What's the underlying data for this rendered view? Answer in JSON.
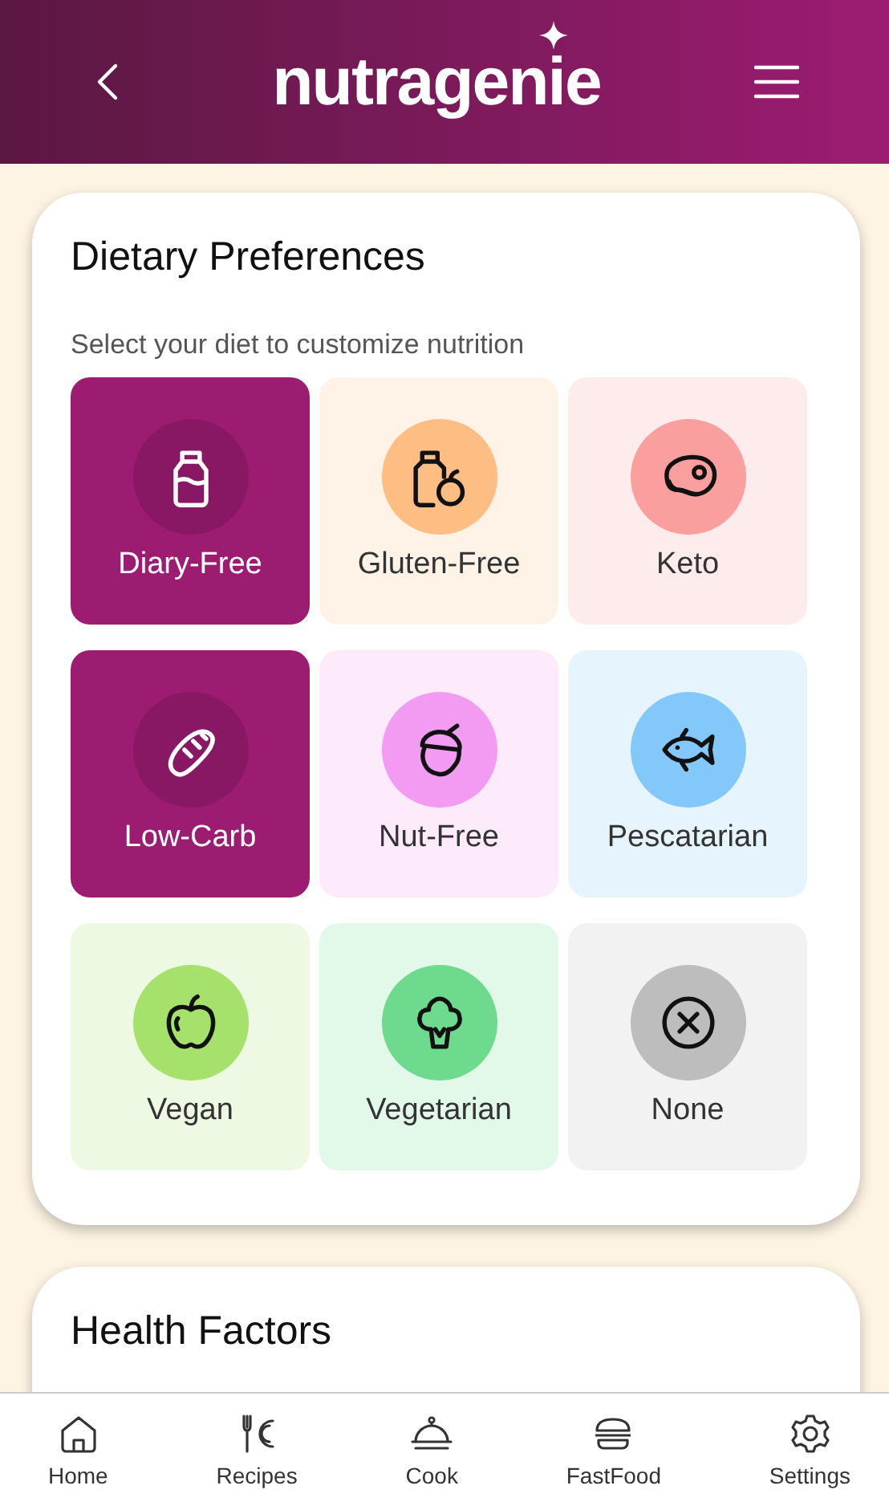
{
  "header": {
    "logo": "nutragenie"
  },
  "dietary_preferences": {
    "title": "Dietary Preferences",
    "subtitle": "Select your diet to customize nutrition",
    "options": [
      {
        "label": "Diary-Free",
        "kind": "bottle",
        "color": "#891864",
        "selected": true
      },
      {
        "label": "Gluten-Free",
        "kind": "bottle-apple",
        "color": "#fdbd83",
        "selected": false
      },
      {
        "label": "Keto",
        "kind": "steak",
        "color": "#fa9e9e",
        "selected": false
      },
      {
        "label": "Low-Carb",
        "kind": "bread",
        "color": "#891864",
        "selected": true
      },
      {
        "label": "Nut-Free",
        "kind": "acorn",
        "color": "#f39af2",
        "selected": false
      },
      {
        "label": "Pescatarian",
        "kind": "fish",
        "color": "#83c8fa",
        "selected": false
      },
      {
        "label": "Vegan",
        "kind": "apple",
        "color": "#a6e16c",
        "selected": false
      },
      {
        "label": "Vegetarian",
        "kind": "broccoli",
        "color": "#6dda8d",
        "selected": false
      },
      {
        "label": "None",
        "kind": "none",
        "color": "#bdbdbd",
        "selected": false
      }
    ]
  },
  "health_factors": {
    "title": "Health Factors"
  },
  "bottom_nav": [
    {
      "label": "Home",
      "kind": "home"
    },
    {
      "label": "Recipes",
      "kind": "recipes"
    },
    {
      "label": "Cook",
      "kind": "cook"
    },
    {
      "label": "FastFood",
      "kind": "fastfood"
    },
    {
      "label": "Settings",
      "kind": "settings"
    }
  ]
}
